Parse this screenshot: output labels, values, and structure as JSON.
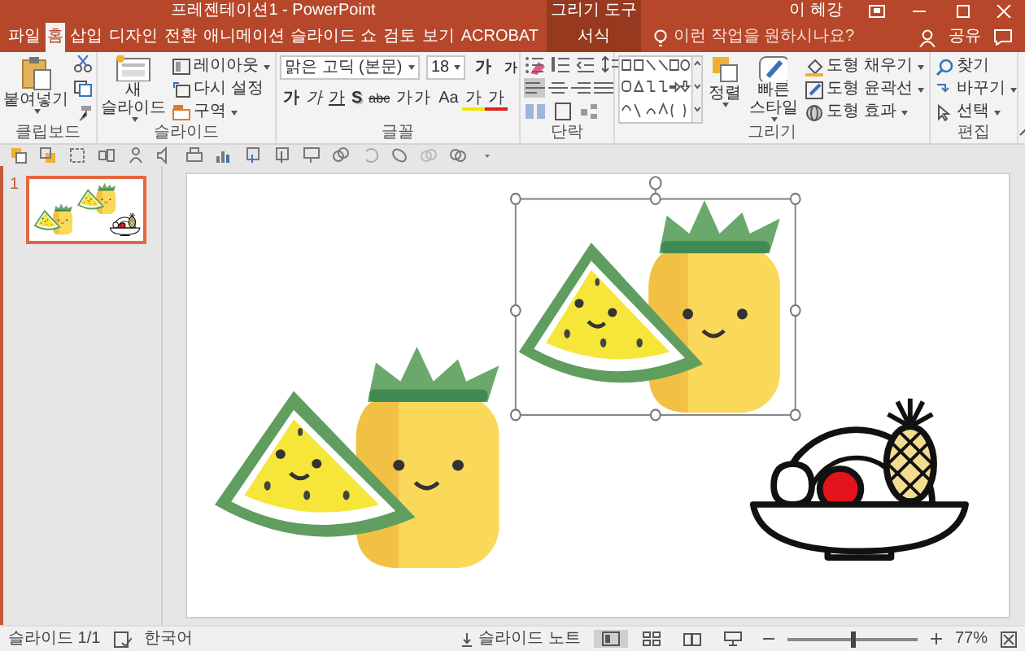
{
  "window": {
    "title": "프레젠테이션1 - PowerPoint",
    "tool_group": "그리기 도구",
    "user": "이 혜강"
  },
  "tabs": [
    {
      "label": "파일",
      "selected": false,
      "kind": "normal"
    },
    {
      "label": "홈",
      "selected": true,
      "kind": "normal"
    },
    {
      "label": "삽입",
      "selected": false,
      "kind": "normal"
    },
    {
      "label": "디자인",
      "selected": false,
      "kind": "normal"
    },
    {
      "label": "전환",
      "selected": false,
      "kind": "normal"
    },
    {
      "label": "애니메이션",
      "selected": false,
      "kind": "normal"
    },
    {
      "label": "슬라이드 쇼",
      "selected": false,
      "kind": "normal"
    },
    {
      "label": "검토",
      "selected": false,
      "kind": "normal"
    },
    {
      "label": "보기",
      "selected": false,
      "kind": "normal"
    },
    {
      "label": "ACROBAT",
      "selected": false,
      "kind": "normal"
    },
    {
      "label": "서식",
      "selected": false,
      "kind": "context"
    }
  ],
  "tell_me": {
    "placeholder": "이런 작업을 원하시나요?"
  },
  "share": "공유",
  "ribbon": {
    "clipboard": {
      "label": "클립보드",
      "paste": "붙여넣기"
    },
    "slides": {
      "label": "슬라이드",
      "new_slide": "새 슬라이드",
      "layout": "레이아웃",
      "reset": "다시 설정",
      "section": "구역"
    },
    "font": {
      "label": "글꼴",
      "font_name": "맑은 고딕 (본문)",
      "font_size": "18",
      "grow": "가",
      "shrink": "가",
      "buttons": [
        "가",
        "가",
        "가",
        "S",
        "abc",
        "가가",
        "Aa",
        "가",
        "가"
      ]
    },
    "paragraph": {
      "label": "단락",
      "align": [
        {
          "selected": true
        },
        {
          "selected": false
        },
        {
          "selected": false
        },
        {
          "selected": false
        }
      ]
    },
    "drawing": {
      "label": "그리기",
      "arrange": "정렬",
      "quick_styles": "빠른 스타일",
      "fill": "도형 채우기",
      "outline": "도형 윤곽선",
      "effects": "도형 효과"
    },
    "editing": {
      "label": "편집",
      "find": "찾기",
      "replace": "바꾸기",
      "select": "선택"
    }
  },
  "slide_thumbnails": [
    {
      "number": "1",
      "selected": true
    }
  ],
  "slide": {
    "objects": [
      {
        "kind": "fruit-pair",
        "selected": false
      },
      {
        "kind": "fruit-pair",
        "selected": true
      },
      {
        "kind": "fruit-bowl",
        "selected": false
      }
    ]
  },
  "status_bar": {
    "slide_count": "슬라이드 1/1",
    "language": "한국어",
    "notes": "슬라이드 노트",
    "views": [
      {
        "selected": true
      },
      {
        "selected": false
      },
      {
        "selected": false
      },
      {
        "selected": false
      }
    ],
    "zoom": {
      "level": 0.5,
      "reading": "77%"
    }
  }
}
